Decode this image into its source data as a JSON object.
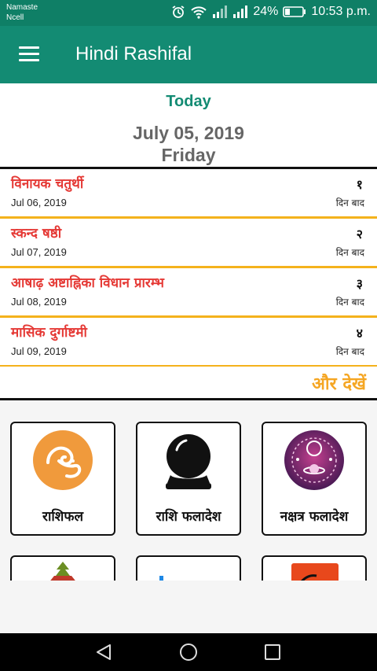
{
  "status_bar": {
    "carrier_line1": "Namaste",
    "carrier_line2": "Ncell",
    "battery": "24%",
    "time": "10:53 p.m."
  },
  "app_bar": {
    "title": "Hindi Rashifal"
  },
  "today": {
    "label": "Today",
    "date": "July 05, 2019",
    "day": "Friday"
  },
  "events": [
    {
      "title": "विनायक चतुर्थी",
      "date": "Jul 06, 2019",
      "count": "१",
      "unit": "दिन बाद"
    },
    {
      "title": "स्कन्द षष्ठी",
      "date": "Jul 07, 2019",
      "count": "२",
      "unit": "दिन बाद"
    },
    {
      "title": "आषाढ़ अष्टाह्निका विधान प्रारम्भ",
      "date": "Jul 08, 2019",
      "count": "३",
      "unit": "दिन बाद"
    },
    {
      "title": "मासिक दुर्गाष्टमी",
      "date": "Jul 09, 2019",
      "count": "४",
      "unit": "दिन बाद"
    }
  ],
  "more_label": "और देखें",
  "tiles": [
    {
      "label": "राशिफल",
      "icon": "aries-ram-icon"
    },
    {
      "label": "राशि फलादेश",
      "icon": "crystal-ball-icon"
    },
    {
      "label": "नक्षत्र फलादेश",
      "icon": "zodiac-wheel-icon"
    }
  ],
  "colors": {
    "accent": "#138b73",
    "event_title": "#e53935",
    "divider": "#f4b21c",
    "more": "#f5a623"
  }
}
